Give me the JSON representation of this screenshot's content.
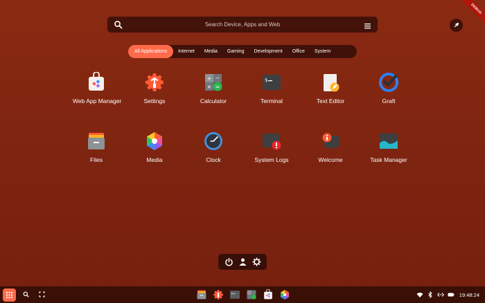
{
  "search": {
    "placeholder": "Search Device, Apps and Web"
  },
  "debug_banner": "DEBUG",
  "categories": [
    {
      "label": "All Applications",
      "active": true
    },
    {
      "label": "Internet"
    },
    {
      "label": "Media"
    },
    {
      "label": "Gaming"
    },
    {
      "label": "Development"
    },
    {
      "label": "Office"
    },
    {
      "label": "System"
    }
  ],
  "apps": [
    {
      "label": "Web App Manager",
      "icon": "web-app-manager-icon"
    },
    {
      "label": "Settings",
      "icon": "settings-icon"
    },
    {
      "label": "Calculator",
      "icon": "calculator-icon"
    },
    {
      "label": "Terminal",
      "icon": "terminal-icon"
    },
    {
      "label": "Text Editor",
      "icon": "text-editor-icon"
    },
    {
      "label": "Graft",
      "icon": "graft-icon"
    },
    {
      "label": "Files",
      "icon": "files-icon"
    },
    {
      "label": "Media",
      "icon": "media-icon"
    },
    {
      "label": "Clock",
      "icon": "clock-icon"
    },
    {
      "label": "System Logs",
      "icon": "system-logs-icon"
    },
    {
      "label": "Welcome",
      "icon": "welcome-icon"
    },
    {
      "label": "Task Manager",
      "icon": "task-manager-icon"
    }
  ],
  "power_menu": [
    "power-icon",
    "user-icon",
    "gear-icon"
  ],
  "taskbar": {
    "pinned": [
      "files-icon",
      "settings-icon",
      "terminal-icon",
      "calculator-icon",
      "web-app-manager-icon",
      "media-icon"
    ],
    "tray": [
      "wifi-icon",
      "bluetooth-icon",
      "network-icon",
      "battery-icon"
    ],
    "clock": "19:48:24"
  },
  "colors": {
    "accent": "#ff6b4a",
    "background": "#7d2410",
    "panel": "#3a0f06"
  }
}
